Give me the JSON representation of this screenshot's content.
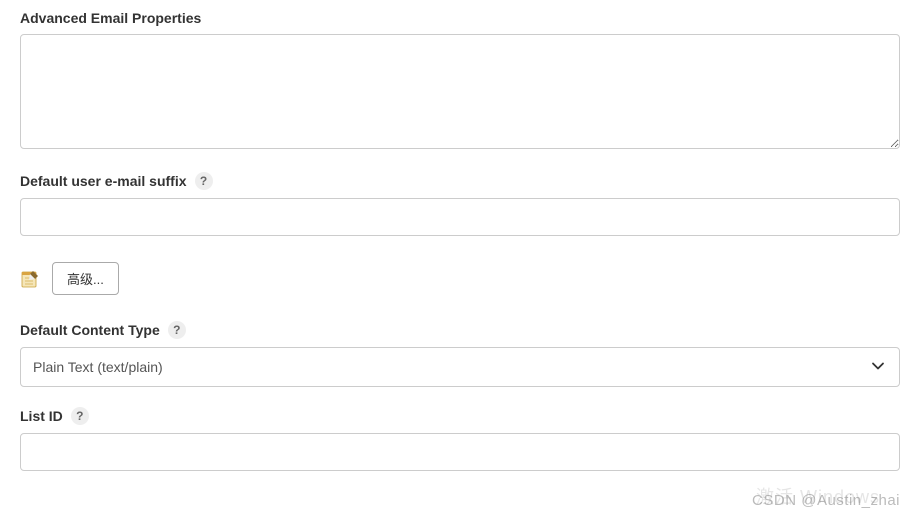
{
  "form": {
    "advancedEmail": {
      "label": "Advanced Email Properties",
      "value": ""
    },
    "defaultSuffix": {
      "label": "Default user e-mail suffix",
      "value": ""
    },
    "advancedButton": {
      "label": "高级..."
    },
    "contentType": {
      "label": "Default Content Type",
      "selected": "Plain Text (text/plain)"
    },
    "listId": {
      "label": "List ID",
      "value": ""
    }
  },
  "helpGlyph": "?",
  "watermark": {
    "bg": "激活 Windows",
    "fg": "CSDN @Austin_zhai"
  }
}
